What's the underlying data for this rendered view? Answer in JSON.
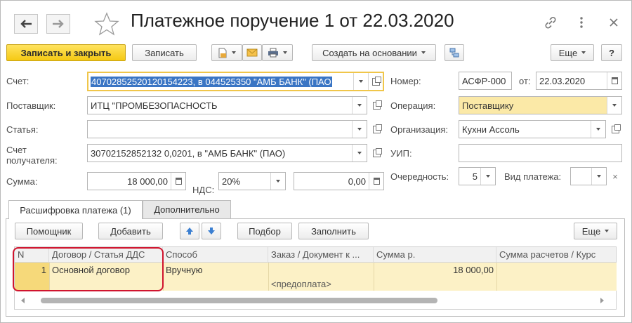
{
  "window": {
    "title": "Платежное поручение 1 от 22.03.2020"
  },
  "toolbar": {
    "save_close": "Записать и закрыть",
    "save": "Записать",
    "create_based": "Создать на основании",
    "more": "Еще",
    "help": "?"
  },
  "form": {
    "account": {
      "label": "Счет:",
      "value": "40702852520120154223, в 044525350 \"АМБ БАНК\" (ПАО"
    },
    "supplier": {
      "label": "Поставщик:",
      "value": "ИТЦ \"ПРОМБЕЗОПАСНОСТЬ"
    },
    "article": {
      "label": "Статья:",
      "value": ""
    },
    "recipient_account": {
      "label_line1": "Счет",
      "label_line2": "получателя:",
      "value": "30702152852132 0,0201, в \"АМБ БАНК\" (ПАО)"
    },
    "amount": {
      "label": "Сумма:",
      "value": "18 000,00"
    },
    "vat": {
      "label": "НДС:",
      "rate": "20%",
      "value": "0,00"
    },
    "number": {
      "label": "Номер:",
      "value": "АСФР-000"
    },
    "date": {
      "label": "от:",
      "value": "22.03.2020"
    },
    "operation": {
      "label": "Операция:",
      "value": "Поставщику"
    },
    "organization": {
      "label": "Организация:",
      "value": "Кухни Ассоль"
    },
    "uip": {
      "label": "УИП:",
      "value": ""
    },
    "priority": {
      "label": "Очередность:",
      "value": "5"
    },
    "payment_type": {
      "label": "Вид платежа:",
      "value": ""
    }
  },
  "tabs": [
    {
      "label": "Расшифровка платежа (1)"
    },
    {
      "label": "Дополнительно"
    }
  ],
  "table_toolbar": {
    "assistant": "Помощник",
    "add": "Добавить",
    "selection": "Подбор",
    "fill": "Заполнить",
    "more": "Еще"
  },
  "table": {
    "columns": [
      "N",
      "Договор / Статья ДДС",
      "Способ",
      "Заказ / Документ к ...",
      "Сумма р.",
      "Сумма расчетов / Курс"
    ],
    "rows": [
      {
        "n": "1",
        "contract": "Основной договор",
        "method": "Вручную",
        "order": "<предоплата>",
        "amount": "18 000,00",
        "settlement": ""
      }
    ]
  },
  "colors": {
    "primary_button": "#f5c913",
    "selection": "#3a75c4",
    "row_highlight": "#fcf1c6",
    "annotation_box": "#d0142e"
  }
}
